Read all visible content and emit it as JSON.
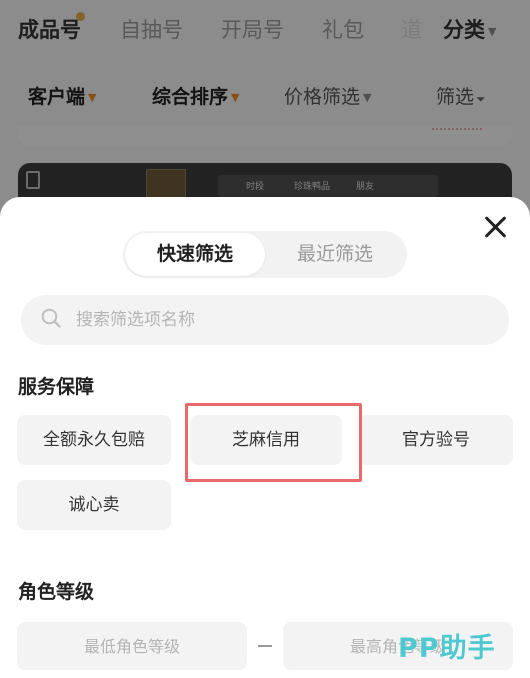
{
  "top_tabs": {
    "items": [
      {
        "label": "成品号",
        "active": true
      },
      {
        "label": "自抽号",
        "active": false
      },
      {
        "label": "开局号",
        "active": false
      },
      {
        "label": "礼包",
        "active": false
      },
      {
        "label": "道",
        "active": false
      }
    ],
    "category_label": "分类"
  },
  "filter_bar": {
    "client": "客户端",
    "sort": "综合排序",
    "price_filter": "价格筛选",
    "filter": "筛选"
  },
  "bg_card": {
    "strip_texts": [
      "时段",
      "珍珠鸭品",
      "朋友"
    ]
  },
  "sheet": {
    "segment": {
      "quick": "快速筛选",
      "recent": "最近筛选"
    },
    "search": {
      "placeholder": "搜索筛选项名称",
      "value": ""
    },
    "service": {
      "title": "服务保障",
      "options": [
        "全额永久包赔",
        "芝麻信用",
        "官方验号",
        "诚心卖"
      ]
    },
    "level": {
      "title": "角色等级",
      "min_placeholder": "最低角色等级",
      "max_placeholder": "最高角色等级"
    }
  },
  "watermark": "PP助手",
  "colors": {
    "accent_orange": "#e28a2a",
    "highlight_red": "#e86a6a",
    "watermark_teal": "#4fc8cf",
    "badge_dot": "#e9a94a"
  }
}
